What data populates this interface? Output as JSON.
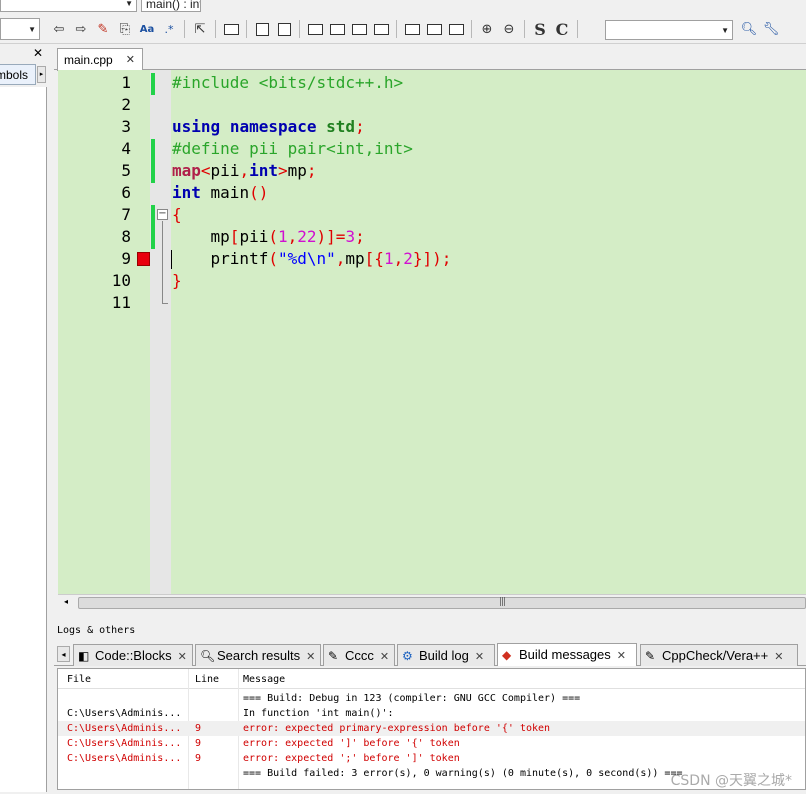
{
  "toolbar": {
    "scope_select": "",
    "function_select": "main() : int",
    "search_select": ""
  },
  "management": {
    "tab_label": "Symbols"
  },
  "editor": {
    "file_tab": "main.cpp",
    "line_numbers": [
      "1",
      "2",
      "3",
      "4",
      "5",
      "6",
      "7",
      "8",
      "9",
      "10",
      "11"
    ]
  },
  "logs": {
    "title": "Logs & others",
    "tabs": [
      "Code::Blocks",
      "Search results",
      "Cccc",
      "Build log",
      "Build messages",
      "CppCheck/Vera++"
    ],
    "columns": [
      "File",
      "Line",
      "Message"
    ],
    "rows": [
      {
        "file": "",
        "line": "",
        "message": "=== Build: Debug in 123 (compiler: GNU GCC Compiler) ==="
      },
      {
        "file": "C:\\Users\\Adminis...",
        "line": "",
        "message": "In function 'int main()':"
      },
      {
        "file": "C:\\Users\\Adminis...",
        "line": "9",
        "message": "error: expected primary-expression before '{' token"
      },
      {
        "file": "C:\\Users\\Adminis...",
        "line": "9",
        "message": "error: expected ']' before '{' token"
      },
      {
        "file": "C:\\Users\\Adminis...",
        "line": "9",
        "message": "error: expected ';' before ']' token"
      },
      {
        "file": "",
        "line": "",
        "message": "=== Build failed: 3 error(s), 0 warning(s) (0 minute(s), 0 second(s)) ==="
      }
    ]
  },
  "watermark": "CSDN @天翼之城*"
}
